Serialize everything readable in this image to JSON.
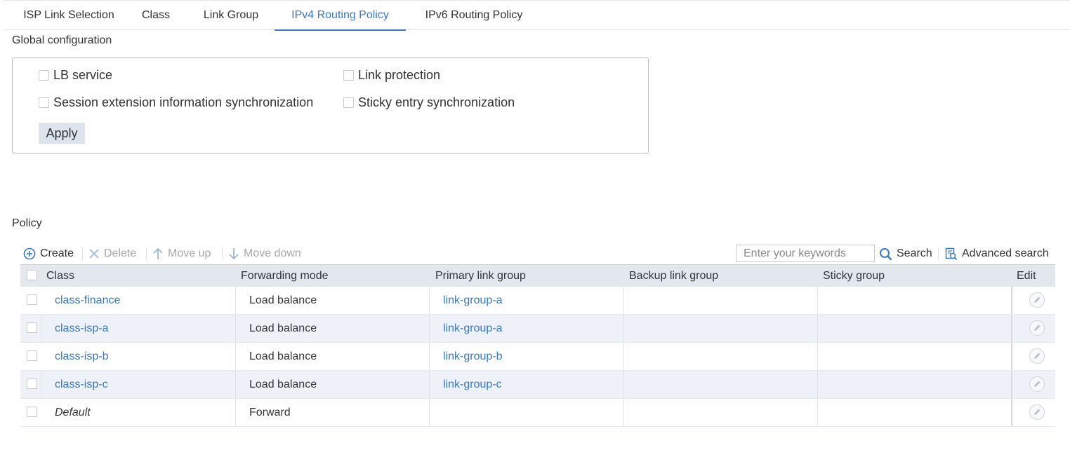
{
  "tabs": [
    {
      "label": "ISP Link Selection",
      "active": false
    },
    {
      "label": "Class",
      "active": false
    },
    {
      "label": "Link Group",
      "active": false
    },
    {
      "label": "IPv4 Routing Policy",
      "active": true
    },
    {
      "label": "IPv6 Routing Policy",
      "active": false
    }
  ],
  "global_config": {
    "title": "Global configuration",
    "options": {
      "lb_service": {
        "label": "LB service",
        "checked": false
      },
      "link_protection": {
        "label": "Link protection",
        "checked": false
      },
      "session_sync": {
        "label": "Session extension information synchronization",
        "checked": false
      },
      "sticky_sync": {
        "label": "Sticky entry synchronization",
        "checked": false
      }
    },
    "apply_label": "Apply"
  },
  "policy": {
    "title": "Policy",
    "toolbar": {
      "create": "Create",
      "delete": "Delete",
      "move_up": "Move up",
      "move_down": "Move down",
      "search_placeholder": "Enter your keywords",
      "search": "Search",
      "advanced_search": "Advanced search"
    },
    "columns": {
      "class": "Class",
      "forwarding_mode": "Forwarding mode",
      "primary_link_group": "Primary link group",
      "backup_link_group": "Backup link group",
      "sticky_group": "Sticky group",
      "edit": "Edit"
    },
    "rows": [
      {
        "class": "class-finance",
        "forwarding_mode": "Load balance",
        "primary_link_group": "link-group-a",
        "backup_link_group": "",
        "sticky_group": ""
      },
      {
        "class": "class-isp-a",
        "forwarding_mode": "Load balance",
        "primary_link_group": "link-group-a",
        "backup_link_group": "",
        "sticky_group": ""
      },
      {
        "class": "class-isp-b",
        "forwarding_mode": "Load balance",
        "primary_link_group": "link-group-b",
        "backup_link_group": "",
        "sticky_group": ""
      },
      {
        "class": "class-isp-c",
        "forwarding_mode": "Load balance",
        "primary_link_group": "link-group-c",
        "backup_link_group": "",
        "sticky_group": ""
      },
      {
        "class": "Default",
        "forwarding_mode": "Forward",
        "primary_link_group": "",
        "backup_link_group": "",
        "sticky_group": ""
      }
    ]
  },
  "colors": {
    "accent": "#3a78c3",
    "header_bg": "#e3e8ef",
    "alt_row_bg": "#eef2f8",
    "apply_bg": "#dde4ee",
    "disabled_text": "#a8a8a8"
  }
}
